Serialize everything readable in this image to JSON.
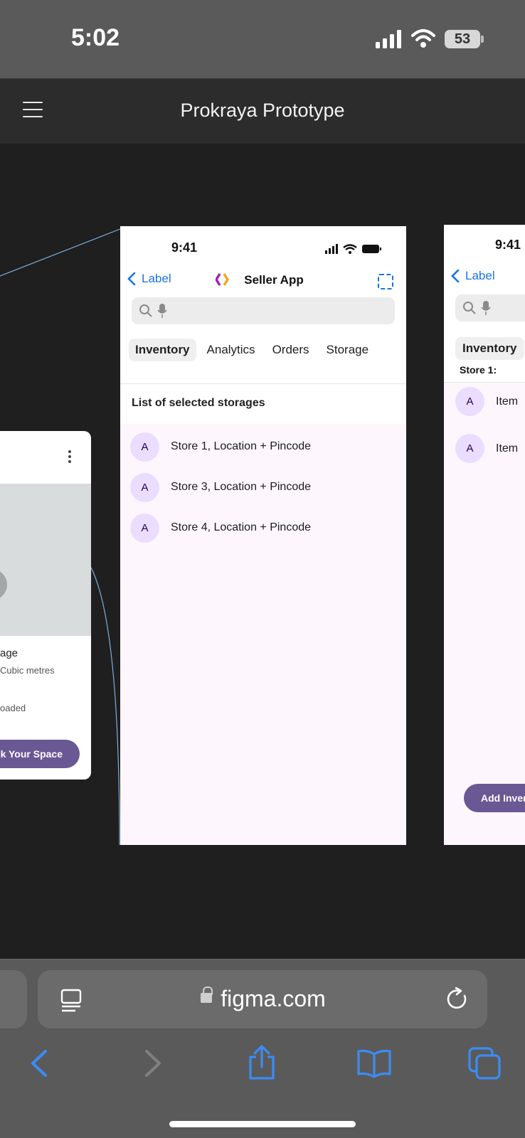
{
  "status_bar": {
    "time": "5:02",
    "battery": "53"
  },
  "figma": {
    "title": "Prokraya Prototype"
  },
  "left_card": {
    "title_fragment": "age",
    "subtitle_fragment": "Cubic metres",
    "status_fragment": "oaded",
    "button_fragment": "ck Your Space"
  },
  "frame": {
    "time": "9:41",
    "back_label": "Label",
    "title": "Seller App",
    "tabs": [
      "Inventory",
      "Analytics",
      "Orders",
      "Storage"
    ],
    "section_title": "List of selected storages",
    "rows": [
      {
        "avatar": "A",
        "label": "Store 1, Location + Pincode"
      },
      {
        "avatar": "A",
        "label": "Store 3, Location + Pincode"
      },
      {
        "avatar": "A",
        "label": "Store 4, Location + Pincode"
      }
    ]
  },
  "right_frame": {
    "time": "9:41",
    "back_label": "Label",
    "tab": "Inventory",
    "store_label": "Store 1:",
    "rows": [
      {
        "avatar": "A",
        "label": "Item"
      },
      {
        "avatar": "A",
        "label": "Item"
      }
    ],
    "button_fragment": "Add Inver"
  },
  "safari": {
    "url": "figma.com"
  },
  "colors": {
    "accent_blue": "#1a73e8",
    "button_purple": "#6a5894",
    "avatar_bg": "#eaddff"
  }
}
